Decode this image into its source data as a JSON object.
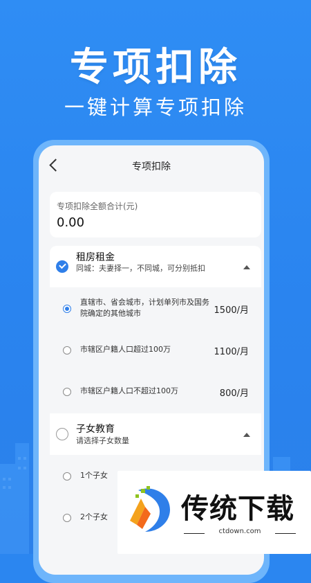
{
  "hero": {
    "title": "专项扣除",
    "subtitle": "一键计算专项扣除"
  },
  "app": {
    "page_title": "专项扣除",
    "total": {
      "label": "专项扣除全额合计(元)",
      "value": "0.00"
    },
    "sections": [
      {
        "title": "租房租金",
        "description": "同城：夫妻择一，不同城，可分别抵扣",
        "checked": true,
        "expanded": true,
        "options": [
          {
            "text": "直辖市、省会城市，计划单列市及国务院确定的其他城市",
            "amount": "1500/月",
            "selected": true
          },
          {
            "text": "市辖区户籍人口超过100万",
            "amount": "1100/月",
            "selected": false
          },
          {
            "text": "市辖区户籍人口不超过100万",
            "amount": "800/月",
            "selected": false
          }
        ]
      },
      {
        "title": "子女教育",
        "description": "请选择子女数量",
        "checked": false,
        "expanded": true,
        "options": [
          {
            "text": "1个子女",
            "selected": false
          },
          {
            "text": "2个子女",
            "selected": false
          }
        ]
      }
    ]
  },
  "watermark": {
    "brand": "传统下载",
    "url": "ctdown.com"
  },
  "colors": {
    "background": "#2b86f0",
    "accent": "#2f7fe9",
    "phone_frame": "#6eb5fb"
  }
}
